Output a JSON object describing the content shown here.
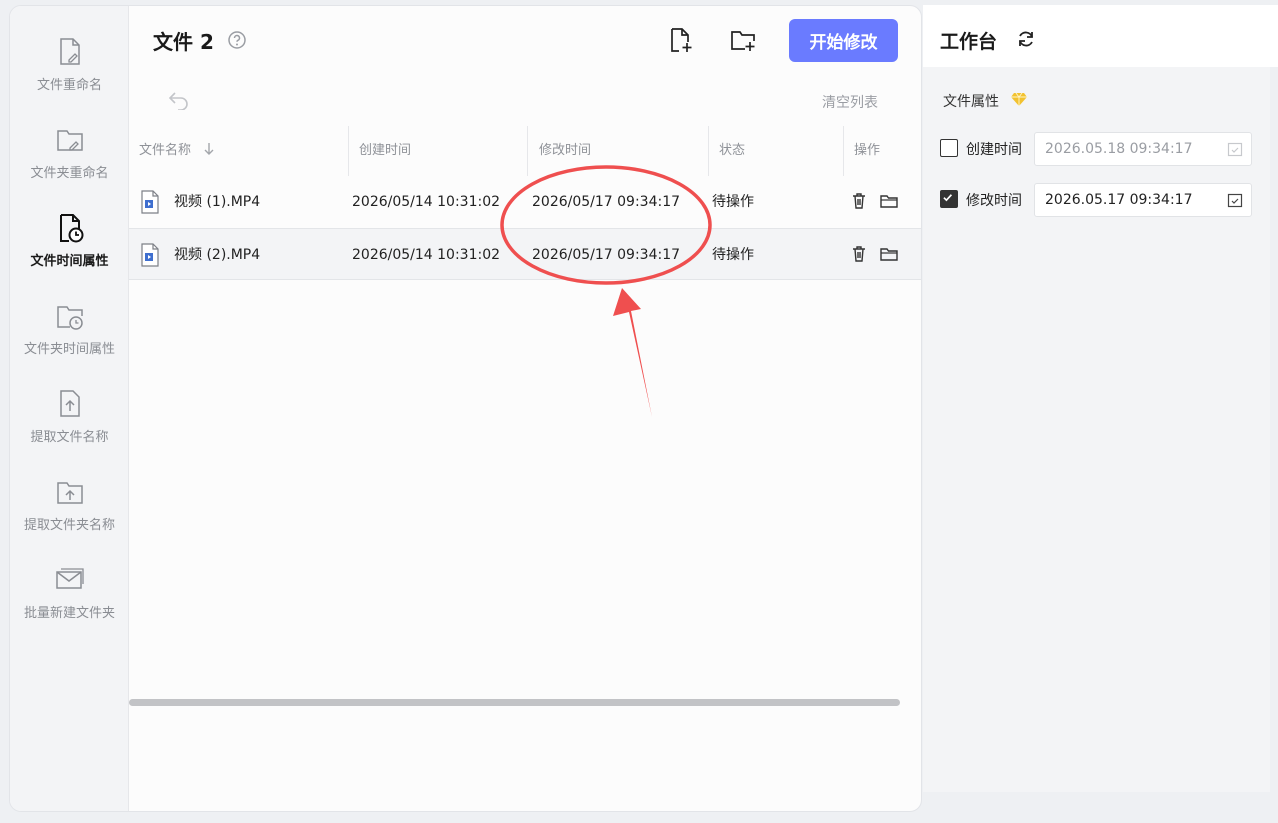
{
  "sidebar": {
    "items": [
      {
        "label": "文件重命名",
        "icon": "file-edit-icon",
        "active": false
      },
      {
        "label": "文件夹重命名",
        "icon": "folder-edit-icon",
        "active": false
      },
      {
        "label": "文件时间属性",
        "icon": "file-clock-icon",
        "active": true
      },
      {
        "label": "文件夹时间属性",
        "icon": "folder-clock-icon",
        "active": false
      },
      {
        "label": "提取文件名称",
        "icon": "file-upload-icon",
        "active": false
      },
      {
        "label": "提取文件夹名称",
        "icon": "folder-upload-icon",
        "active": false
      },
      {
        "label": "批量新建文件夹",
        "icon": "mail-folder-icon",
        "active": false
      }
    ]
  },
  "header": {
    "title": "文件 2",
    "start_button": "开始修改",
    "clear_list": "清空列表"
  },
  "table": {
    "columns": [
      "文件名称",
      "创建时间",
      "修改时间",
      "状态",
      "操作"
    ],
    "rows": [
      {
        "name": "视频 (1).MP4",
        "created": "2026/05/14 10:31:02",
        "modified": "2026/05/17 09:34:17",
        "status": "待操作"
      },
      {
        "name": "视频 (2).MP4",
        "created": "2026/05/14 10:31:02",
        "modified": "2026/05/17 09:34:17",
        "status": "待操作"
      }
    ]
  },
  "panel": {
    "title": "工作台",
    "attr_label": "文件属性",
    "created": {
      "label": "创建时间",
      "value": "2026.05.18 09:34:17",
      "checked": false
    },
    "modified": {
      "label": "修改时间",
      "value": "2026.05.17 09:34:17",
      "checked": true
    }
  },
  "colors": {
    "accent": "#6a7bff",
    "annotation": "#ef4f4f",
    "diamond": "#f2c230"
  }
}
